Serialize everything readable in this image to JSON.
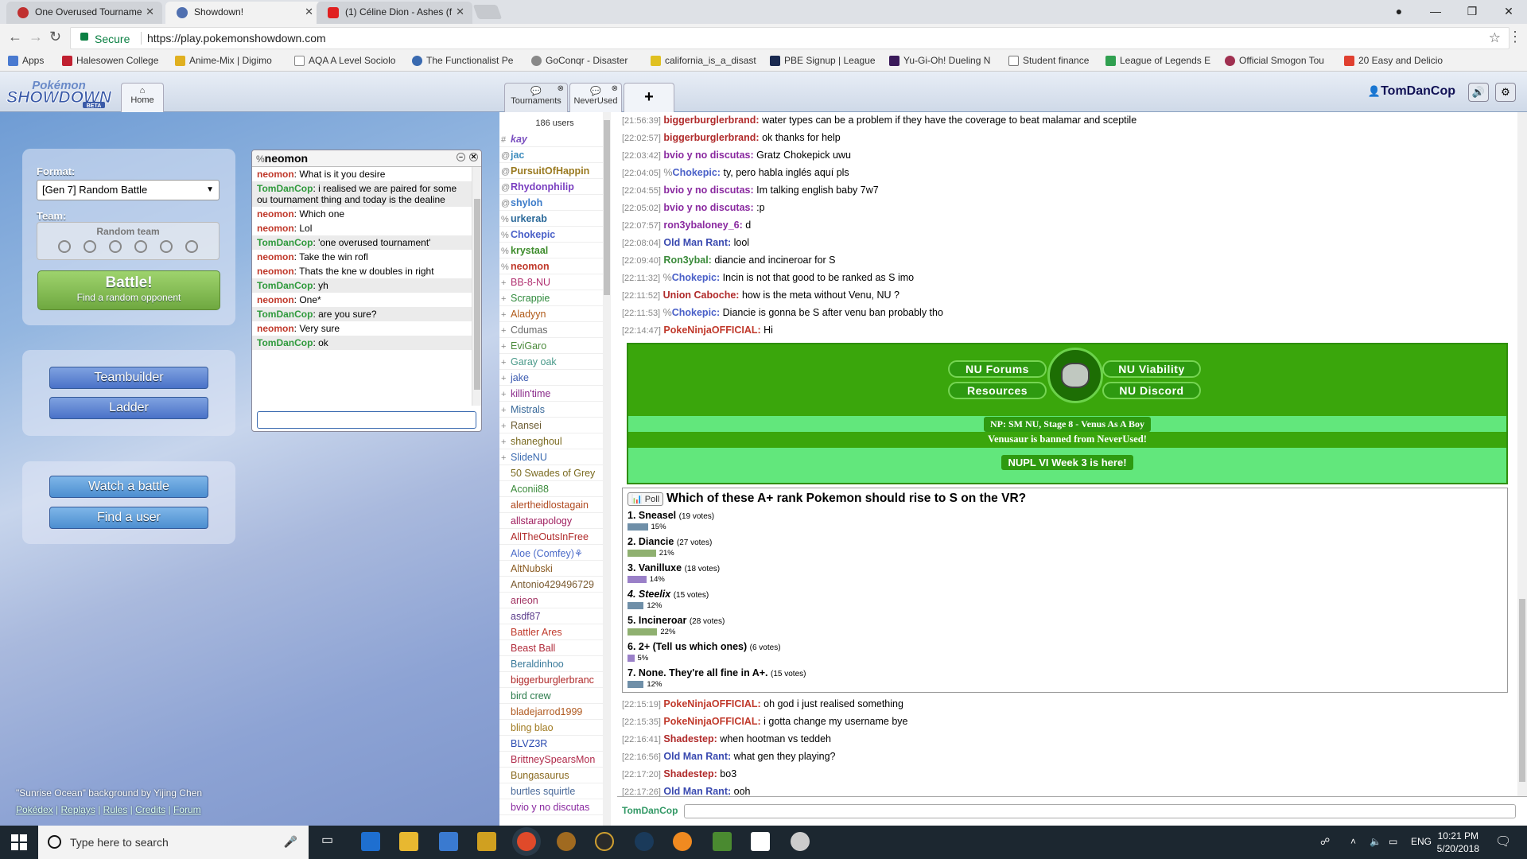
{
  "browser": {
    "tabs": [
      {
        "title": "One Overused Tourname",
        "active": false
      },
      {
        "title": "Showdown!",
        "active": true
      },
      {
        "title": "(1) Céline Dion - Ashes (f",
        "active": false
      }
    ],
    "secure_label": "Secure",
    "url": "https://play.pokemonshowdown.com",
    "bookmarks": [
      "Apps",
      "Halesowen College",
      "Anime-Mix | Digimo",
      "AQA A Level Sociolo",
      "The Functionalist Pe",
      "GoConqr - Disaster",
      "california_is_a_disast",
      "PBE Signup | League",
      "Yu-Gi-Oh! Dueling N",
      "Student finance",
      "League of Legends E",
      "Official Smogon Tou",
      "20 Easy and Delicio"
    ]
  },
  "header": {
    "home_tab": "Home",
    "rooms": [
      {
        "label": "Tournaments"
      },
      {
        "label": "NeverUsed"
      }
    ],
    "plus": "+",
    "username": "TomDanCop"
  },
  "home": {
    "format_label": "Format:",
    "format_value": "[Gen 7] Random Battle",
    "team_label": "Team:",
    "team_value": "Random team",
    "battle_title": "Battle!",
    "battle_sub": "Find a random opponent",
    "teambuilder": "Teambuilder",
    "ladder": "Ladder",
    "watch": "Watch a battle",
    "find_user": "Find a user",
    "credit": "\"Sunrise Ocean\" background by Yijing Chen",
    "links": [
      "Pokédex",
      "Replays",
      "Rules",
      "Credits",
      "Forum"
    ]
  },
  "pm": {
    "rank": "%",
    "name": "neomon",
    "messages": [
      {
        "user": "neomon",
        "text": "What is it you desire",
        "color": "#c0392b"
      },
      {
        "user": "TomDanCop",
        "text": "i realised we are paired for some ou tournament thing and today is the dealine",
        "color": "#2f9a3c"
      },
      {
        "user": "neomon",
        "text": "Which one",
        "color": "#c0392b"
      },
      {
        "user": "neomon",
        "text": "Lol",
        "color": "#c0392b"
      },
      {
        "user": "TomDanCop",
        "text": "'one overused tournament'",
        "color": "#2f9a3c"
      },
      {
        "user": "neomon",
        "text": "Take the win rofl",
        "color": "#c0392b"
      },
      {
        "user": "neomon",
        "text": "Thats the kne w doubles in right",
        "color": "#c0392b"
      },
      {
        "user": "TomDanCop",
        "text": "yh",
        "color": "#2f9a3c"
      },
      {
        "user": "neomon",
        "text": "One*",
        "color": "#c0392b"
      },
      {
        "user": "TomDanCop",
        "text": "are you sure?",
        "color": "#2f9a3c"
      },
      {
        "user": "neomon",
        "text": "Very sure",
        "color": "#c0392b"
      },
      {
        "user": "TomDanCop",
        "text": "ok",
        "color": "#2f9a3c"
      }
    ]
  },
  "userlist": {
    "count": "186 users",
    "users": [
      {
        "g": "#",
        "name": "kay",
        "color": "#7a4fbf",
        "bold": true,
        "italic": true
      },
      {
        "g": "@",
        "name": "jac",
        "color": "#3d8cbd",
        "bold": true,
        "italic": false
      },
      {
        "g": "@",
        "name": "PursuitOfHappin",
        "color": "#9a7a20",
        "bold": true,
        "italic": false
      },
      {
        "g": "@",
        "name": "Rhydonphilip",
        "color": "#7a3fc0",
        "bold": true,
        "italic": false
      },
      {
        "g": "@",
        "name": "shyloh",
        "color": "#3d7cc9",
        "bold": true,
        "italic": false
      },
      {
        "g": "%",
        "name": "urkerab",
        "color": "#2c6a9a",
        "bold": true,
        "italic": false
      },
      {
        "g": "%",
        "name": "Chokepic",
        "color": "#4a60c8",
        "bold": true,
        "italic": false
      },
      {
        "g": "%",
        "name": "krystaal",
        "color": "#3e8c2c",
        "bold": true,
        "italic": false
      },
      {
        "g": "%",
        "name": "neomon",
        "color": "#c0392b",
        "bold": true,
        "italic": false
      },
      {
        "g": "+",
        "name": "BB-8-NU",
        "color": "#b03070",
        "bold": false,
        "italic": false
      },
      {
        "g": "+",
        "name": "Scrappie",
        "color": "#2f8a3c",
        "bold": false,
        "italic": false
      },
      {
        "g": "+",
        "name": "Aladyyn",
        "color": "#b05a18",
        "bold": false,
        "italic": false
      },
      {
        "g": "+",
        "name": "Cdumas",
        "color": "#6a6a6a",
        "bold": false,
        "italic": false
      },
      {
        "g": "+",
        "name": "EviGaro",
        "color": "#4a8a3a",
        "bold": false,
        "italic": false
      },
      {
        "g": "+",
        "name": "Garay oak",
        "color": "#4a9a8a",
        "bold": false,
        "italic": false
      },
      {
        "g": "+",
        "name": "jake",
        "color": "#3a5ab0",
        "bold": false,
        "italic": false
      },
      {
        "g": "+",
        "name": "killin'time",
        "color": "#8a2a8a",
        "bold": false,
        "italic": false
      },
      {
        "g": "+",
        "name": "Mistrals",
        "color": "#3a6a9a",
        "bold": false,
        "italic": false
      },
      {
        "g": "+",
        "name": "Ransei",
        "color": "#6a5a30",
        "bold": false,
        "italic": false
      },
      {
        "g": "+",
        "name": "shaneghoul",
        "color": "#7a6a20",
        "bold": false,
        "italic": false
      },
      {
        "g": "+",
        "name": "SlideNU",
        "color": "#3a6ab0",
        "bold": false,
        "italic": false
      },
      {
        "g": "",
        "name": "50 Swades of Grey",
        "color": "#7a6a20",
        "bold": false,
        "italic": false
      },
      {
        "g": "",
        "name": "Aconii88",
        "color": "#3a8a3a",
        "bold": false,
        "italic": false
      },
      {
        "g": "",
        "name": "alertheidlostagain",
        "color": "#b04a20",
        "bold": false,
        "italic": false
      },
      {
        "g": "",
        "name": "allstarapology",
        "color": "#a02060",
        "bold": false,
        "italic": false
      },
      {
        "g": "",
        "name": "AllTheOutsInFree",
        "color": "#b02a2a",
        "bold": false,
        "italic": false
      },
      {
        "g": "",
        "name": "Aloe (Comfey)⚘",
        "color": "#4a6ac8",
        "bold": false,
        "italic": false
      },
      {
        "g": "",
        "name": "AltNubski",
        "color": "#8a5a20",
        "bold": false,
        "italic": false
      },
      {
        "g": "",
        "name": "Antonio429496729",
        "color": "#7a5a30",
        "bold": false,
        "italic": false
      },
      {
        "g": "",
        "name": "arieon",
        "color": "#a03060",
        "bold": false,
        "italic": false
      },
      {
        "g": "",
        "name": "asdf87",
        "color": "#5a3a8a",
        "bold": false,
        "italic": false
      },
      {
        "g": "",
        "name": "Battler Ares",
        "color": "#c0392b",
        "bold": false,
        "italic": false
      },
      {
        "g": "",
        "name": "Beast Ball",
        "color": "#b02a3a",
        "bold": false,
        "italic": false
      },
      {
        "g": "",
        "name": "Beraldinhoo",
        "color": "#3a7a9a",
        "bold": false,
        "italic": false
      },
      {
        "g": "",
        "name": "biggerburglerbranc",
        "color": "#b02a2a",
        "bold": false,
        "italic": false
      },
      {
        "g": "",
        "name": "bird crew",
        "color": "#2a7a4a",
        "bold": false,
        "italic": false
      },
      {
        "g": "",
        "name": "bladejarrod1999",
        "color": "#b05a20",
        "bold": false,
        "italic": false
      },
      {
        "g": "",
        "name": "bling blao",
        "color": "#a07a20",
        "bold": false,
        "italic": false
      },
      {
        "g": "",
        "name": "BLVZ3R",
        "color": "#2a4ab0",
        "bold": false,
        "italic": false
      },
      {
        "g": "",
        "name": "BrittneySpearsMon",
        "color": "#b02a4a",
        "bold": false,
        "italic": false
      },
      {
        "g": "",
        "name": "Bungasaurus",
        "color": "#8a6a20",
        "bold": false,
        "italic": false
      },
      {
        "g": "",
        "name": "burtles squirtle",
        "color": "#4a6a9a",
        "bold": false,
        "italic": false
      },
      {
        "g": "",
        "name": "bvio y no discutas",
        "color": "#8a2aa0",
        "bold": false,
        "italic": false
      }
    ]
  },
  "chat": {
    "messages_top": [
      {
        "ts": "[21:56:39]",
        "rank": "",
        "user": "biggerburglerbrand:",
        "text": "water types can be a problem if they have the coverage to beat malamar and sceptile",
        "color": "#b02a2a"
      },
      {
        "ts": "[22:02:57]",
        "rank": "",
        "user": "biggerburglerbrand:",
        "text": "ok thanks for help",
        "color": "#b02a2a"
      },
      {
        "ts": "[22:03:42]",
        "rank": "",
        "user": "bvio y no discutas:",
        "text": "Gratz Chokepick uwu",
        "color": "#8a2aa0"
      },
      {
        "ts": "[22:04:05]",
        "rank": "%",
        "user": "Chokepic:",
        "text": "ty, pero habla inglés aquí pls",
        "color": "#4a60c8"
      },
      {
        "ts": "[22:04:55]",
        "rank": "",
        "user": "bvio y no discutas:",
        "text": "Im talking english baby 7w7",
        "color": "#8a2aa0"
      },
      {
        "ts": "[22:05:02]",
        "rank": "",
        "user": "bvio y no discutas:",
        "text": ":p",
        "color": "#8a2aa0"
      },
      {
        "ts": "[22:07:57]",
        "rank": "",
        "user": "ron3ybaloney_6:",
        "text": "d",
        "color": "#8a2aa0"
      },
      {
        "ts": "[22:08:04]",
        "rank": "",
        "user": "Old Man Rant:",
        "text": "lool",
        "color": "#3a4ab0"
      },
      {
        "ts": "[22:09:40]",
        "rank": "",
        "user": "Ron3ybal:",
        "text": "diancie and incineroar for S",
        "color": "#3a8a3a"
      },
      {
        "ts": "[22:11:32]",
        "rank": "%",
        "user": "Chokepic:",
        "text": "Incin is not that good to be ranked as S imo",
        "color": "#4a60c8"
      },
      {
        "ts": "[22:11:52]",
        "rank": "",
        "user": "Union Caboche:",
        "text": "how is the meta without Venu, NU ?",
        "color": "#b02a2a"
      },
      {
        "ts": "[22:11:53]",
        "rank": "%",
        "user": "Chokepic:",
        "text": "Diancie is gonna be S after venu ban probably tho",
        "color": "#4a60c8"
      },
      {
        "ts": "[22:14:47]",
        "rank": "",
        "user": "PokeNinjaOFFICIAL:",
        "text": "Hi",
        "color": "#c0392b"
      }
    ],
    "banner": {
      "forums": "NU Forums",
      "viability": "NU Viability",
      "resources": "Resources",
      "discord": "NU Discord",
      "np": "NP: SM NU, Stage 8 - Venus As A Boy",
      "ban": "Venusaur is banned from NeverUsed!",
      "nupl": "NUPL VI Week 3 is here!"
    },
    "poll": {
      "badge": "Poll",
      "question": "Which of these A+ rank Pokemon should rise to S on the VR?",
      "options": [
        {
          "label": "1. Sneasel",
          "votes": "(19 votes)",
          "pct": "15%",
          "value": 15,
          "color": "#6f8fa8",
          "italic": false
        },
        {
          "label": "2. Diancie",
          "votes": "(27 votes)",
          "pct": "21%",
          "value": 21,
          "color": "#8fb070",
          "italic": false
        },
        {
          "label": "3. Vanilluxe",
          "votes": "(18 votes)",
          "pct": "14%",
          "value": 14,
          "color": "#9a80c8",
          "italic": false
        },
        {
          "label": "4. Steelix",
          "votes": "(15 votes)",
          "pct": "12%",
          "value": 12,
          "color": "#6f8fa8",
          "italic": true
        },
        {
          "label": "5. Incineroar",
          "votes": "(28 votes)",
          "pct": "22%",
          "value": 22,
          "color": "#8fb070",
          "italic": false
        },
        {
          "label": "6. 2+ (Tell us which ones)",
          "votes": "(6 votes)",
          "pct": "5%",
          "value": 5,
          "color": "#9a80c8",
          "italic": false
        },
        {
          "label": "7. None. They're all fine in A+.",
          "votes": "(15 votes)",
          "pct": "12%",
          "value": 12,
          "color": "#6f8fa8",
          "italic": false
        }
      ]
    },
    "messages_bottom": [
      {
        "ts": "[22:15:19]",
        "rank": "",
        "user": "PokeNinjaOFFICIAL:",
        "text": "oh god i just realised something",
        "color": "#c0392b"
      },
      {
        "ts": "[22:15:35]",
        "rank": "",
        "user": "PokeNinjaOFFICIAL:",
        "text": "i gotta change my username bye",
        "color": "#c0392b"
      },
      {
        "ts": "[22:16:41]",
        "rank": "",
        "user": "Shadestep:",
        "text": "when hootman vs teddeh",
        "color": "#b02a2a"
      },
      {
        "ts": "[22:16:56]",
        "rank": "",
        "user": "Old Man Rant:",
        "text": "what gen they playing?",
        "color": "#3a4ab0"
      },
      {
        "ts": "[22:17:20]",
        "rank": "",
        "user": "Shadestep:",
        "text": "bo3",
        "color": "#b02a2a"
      },
      {
        "ts": "[22:17:26]",
        "rank": "",
        "user": "Old Man Rant:",
        "text": "ooh",
        "color": "#3a4ab0"
      }
    ],
    "input_user": "TomDanCop"
  },
  "taskbar": {
    "search_placeholder": "Type here to search",
    "lang": "ENG",
    "time": "10:21 PM",
    "date": "5/20/2018"
  }
}
